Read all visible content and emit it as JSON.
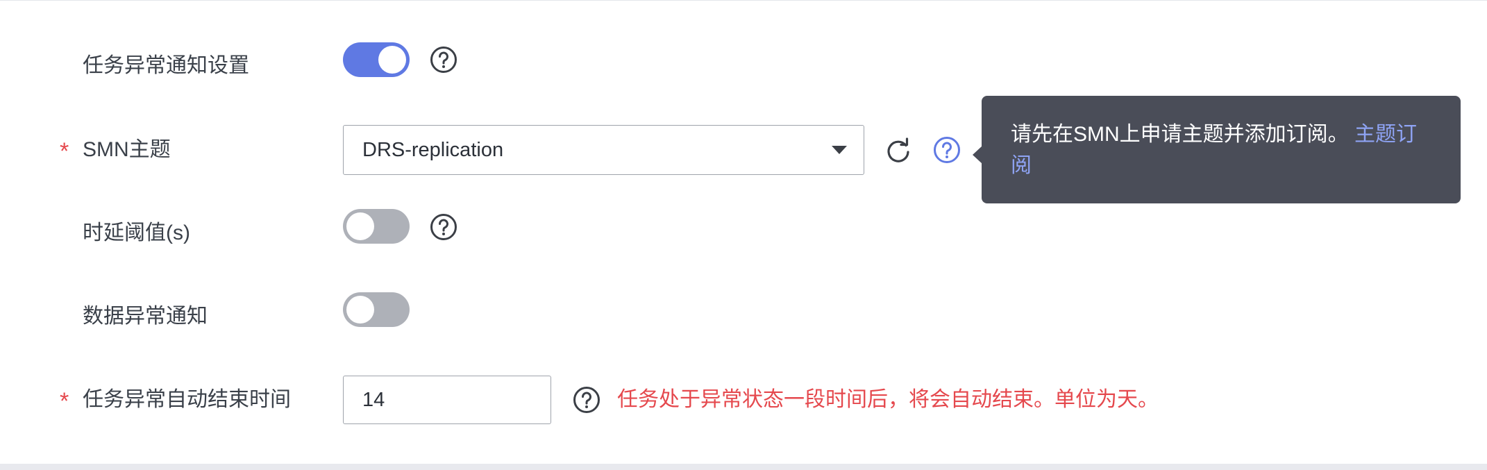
{
  "form": {
    "task_exception_notify": {
      "label": "任务异常通知设置",
      "enabled": true
    },
    "smn_topic": {
      "required_mark": "*",
      "label": "SMN主题",
      "selected_value": "DRS-replication"
    },
    "delay_threshold": {
      "label": "时延阈值(s)",
      "enabled": false
    },
    "data_exception_notify": {
      "label": "数据异常通知",
      "enabled": false
    },
    "auto_end_time": {
      "required_mark": "*",
      "label": "任务异常自动结束时间",
      "value": "14",
      "message": "任务处于异常状态一段时间后，将会自动结束。单位为天。"
    }
  },
  "tooltip": {
    "text": "请先在SMN上申请主题并添加订阅。",
    "link_text": "主题订阅"
  },
  "icons": {
    "help": "question-circle-icon",
    "refresh": "refresh-icon",
    "dropdown": "caret-down-icon"
  },
  "colors": {
    "toggle_on": "#5f79e3",
    "toggle_off": "#aeb1b8",
    "required": "#e5484d",
    "error_text": "#e5484d",
    "tooltip_bg": "#4a4d58",
    "link": "#8fa4f5",
    "help_active": "#5f79e3"
  }
}
